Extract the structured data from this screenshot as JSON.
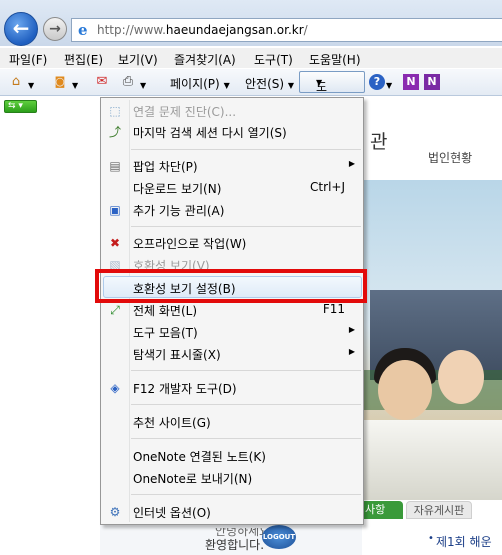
{
  "address_bar": {
    "url_prefix": "http://www.",
    "url_domain": "haeundaejangsan.or.kr",
    "url_suffix": "/"
  },
  "menu_bar": [
    "파일(F)",
    "편집(E)",
    "보기(V)",
    "즐겨찾기(A)",
    "도구(T)",
    "도움말(H)"
  ],
  "command_bar": {
    "page": "페이지(P)",
    "safety": "안전(S)",
    "tools": "도구(O)"
  },
  "page": {
    "header_title": "관",
    "header_link": "법인현황",
    "tab_notice": "사항",
    "tab_board": "자유게시판",
    "notice_item": "제1회 해운",
    "welcome": "환영합니다.",
    "logout": "LOGOUT"
  },
  "tools_menu": {
    "items": [
      {
        "label": "연결 문제 진단(C)...",
        "disabled": true,
        "icon": "diagnose-icon"
      },
      {
        "label": "마지막 검색 세션 다시 열기(S)",
        "icon": "reopen-session-icon"
      },
      {
        "label": "팝업 차단(P)",
        "icon": "popup-blocker-icon",
        "submenu": true
      },
      {
        "label": "다운로드 보기(N)",
        "shortcut": "Ctrl+J"
      },
      {
        "label": "추가 기능 관리(A)",
        "icon": "addons-icon"
      },
      {
        "label": "오프라인으로 작업(W)",
        "icon": "offline-icon"
      },
      {
        "label": "호환성 보기(V)",
        "disabled": true,
        "icon": "compat-view-icon"
      },
      {
        "label": "호환성 보기 설정(B)",
        "highlighted": true
      },
      {
        "label": "전체 화면(L)",
        "shortcut": "F11",
        "icon": "fullscreen-icon"
      },
      {
        "label": "도구 모음(T)",
        "submenu": true
      },
      {
        "label": "탐색기 표시줄(X)",
        "submenu": true
      },
      {
        "label": "F12 개발자 도구(D)",
        "icon": "dev-tools-icon"
      },
      {
        "label": "추천 사이트(G)"
      },
      {
        "label": "OneNote 연결된 노트(K)"
      },
      {
        "label": "OneNote로 보내기(N)"
      },
      {
        "label": "인터넷 옵션(O)",
        "icon": "internet-options-icon"
      }
    ]
  },
  "colors": {
    "highlight_border": "#e20a0a",
    "accent": "#1f5fc0"
  }
}
